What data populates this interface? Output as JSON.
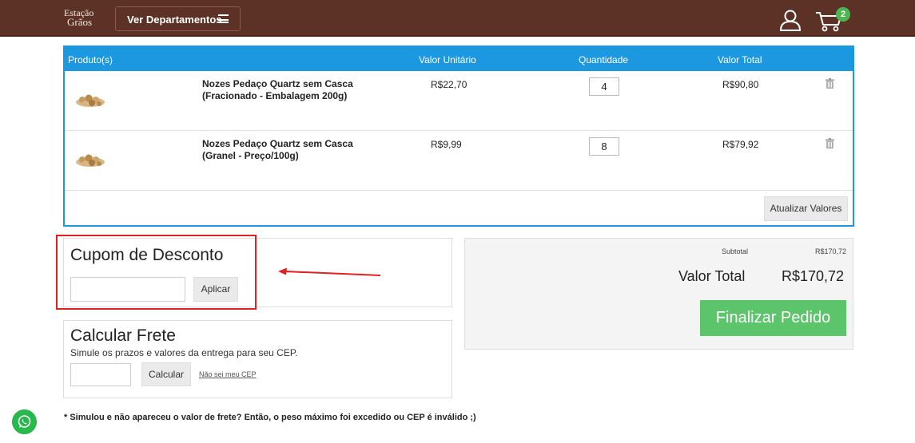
{
  "header": {
    "logo_line1": "Estação",
    "logo_line2": "Grãos",
    "dept_label": "Ver Departamentos",
    "cart_count": "2",
    "colors": {
      "bar": "#5d3226",
      "badge": "#4cb752"
    }
  },
  "cart": {
    "columns": [
      "Produto(s)",
      "Valor Unitário",
      "Quantidade",
      "Valor Total"
    ],
    "items": [
      {
        "name": "Nozes Pedaço Quartz sem Casca (Fracionado - Embalagem 200g)",
        "unit_price": "R$22,70",
        "quantity": "4",
        "total": "R$90,80"
      },
      {
        "name": "Nozes Pedaço Quartz sem Casca (Granel - Preço/100g)",
        "unit_price": "R$9,99",
        "quantity": "8",
        "total": "R$79,92"
      }
    ],
    "update_label": "Atualizar Valores"
  },
  "coupon": {
    "title": "Cupom de Desconto",
    "input_value": "",
    "apply_label": "Aplicar"
  },
  "shipping": {
    "title": "Calcular Frete",
    "subtitle": "Simule os prazos e valores da entrega para seu CEP.",
    "cep_value": "",
    "calc_label": "Calcular",
    "link_label": "Não sei meu CEP"
  },
  "summary": {
    "subtotal_label": "Subtotal",
    "subtotal_value": "R$170,72",
    "total_label": "Valor Total",
    "total_value": "R$170,72",
    "finalize_label": "Finalizar Pedido"
  },
  "note": "* Simulou e não apareceu o valor de frete? Então, o peso máximo foi excedido ou CEP é inválido ;)"
}
